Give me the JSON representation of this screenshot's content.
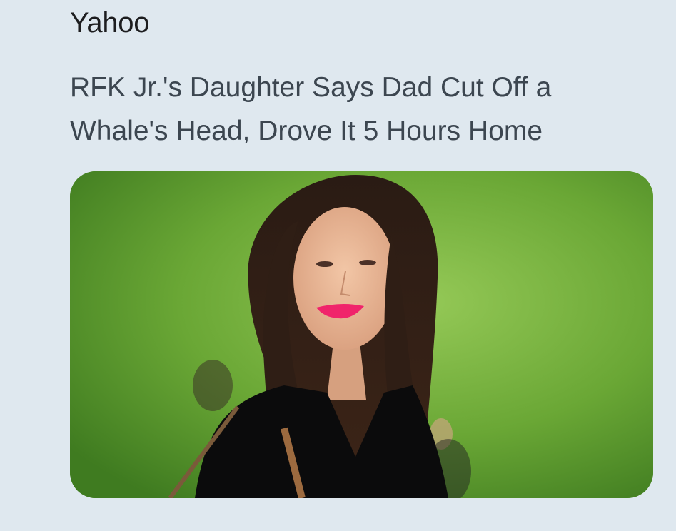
{
  "article": {
    "source": "Yahoo",
    "headline": "RFK Jr.'s Daughter Says Dad Cut Off a Whale's Head, Drove It 5 Hours Home",
    "thumbnail": {
      "subject": "woman-portrait-photo",
      "background_color": "#6fae38"
    }
  }
}
